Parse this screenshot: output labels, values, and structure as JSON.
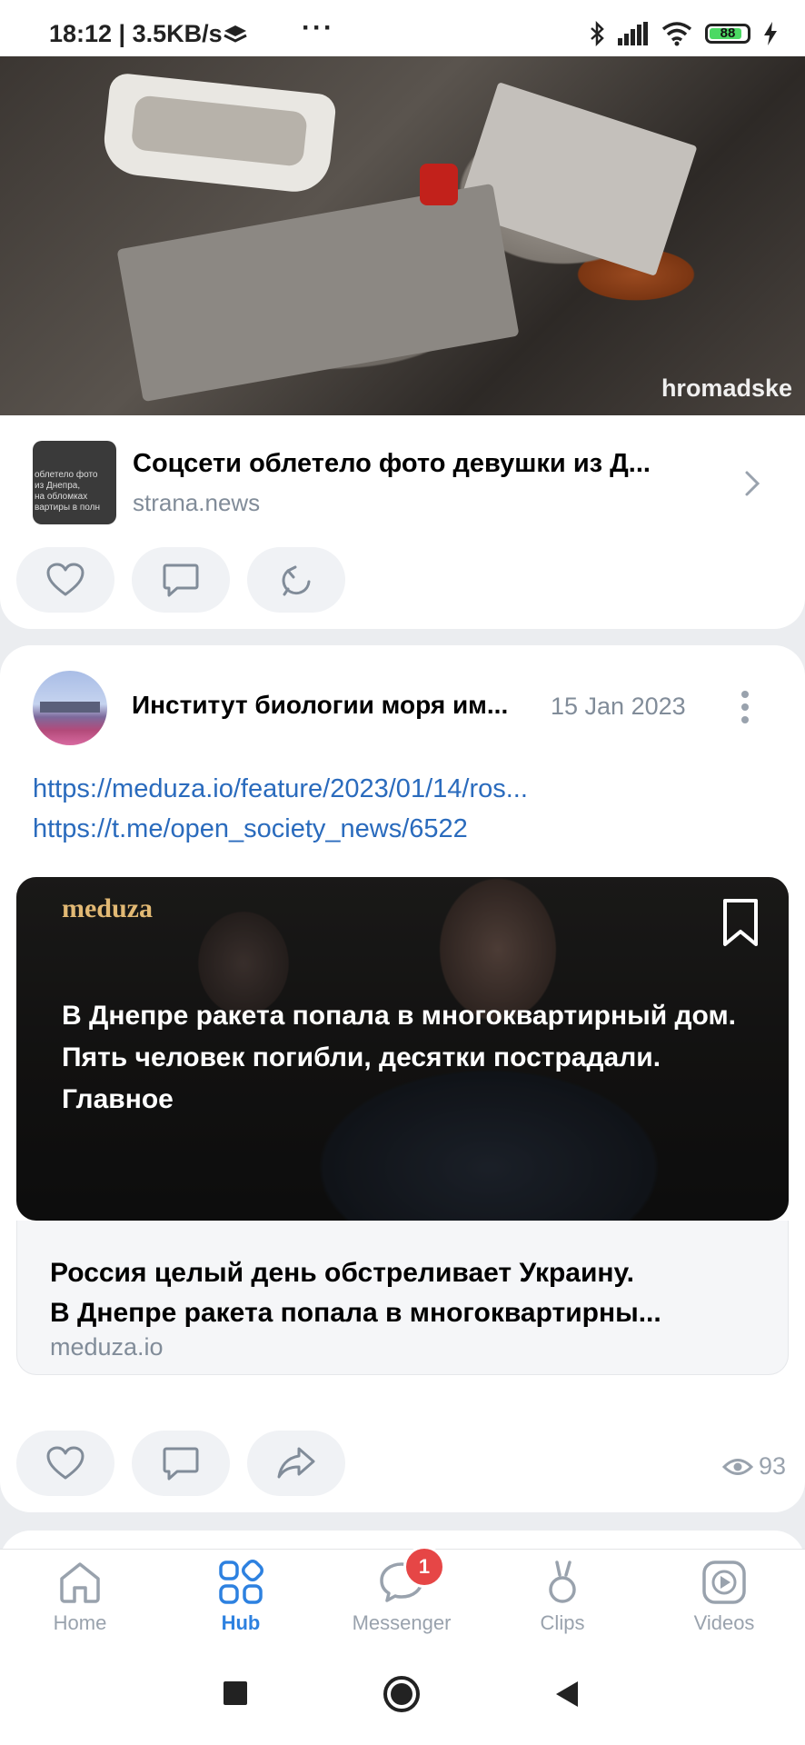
{
  "status_bar": {
    "time_and_speed": "18:12 | 3.5KB/s",
    "more": "···",
    "battery": "88"
  },
  "post1": {
    "hero_watermark": "hromadske",
    "thumb_caption": "облетело фото\nиз Днепра,\nна обломках\nвартиры в полн",
    "link_title": "Соцсети облетело фото девушки из Д...",
    "link_domain": "strana.news"
  },
  "post2": {
    "author": "Институт биологии моря им...",
    "date": "15 Jan 2023",
    "links": [
      "https://meduza.io/feature/2023/01/14/ros...",
      "https://t.me/open_society_news/6522"
    ],
    "media_logo": "meduza",
    "media_headline": "В Днепре ракета попала в многоквартирный дом. Пять человек погибли, десятки пострадали. Главное",
    "card_title_line1": "Россия целый день обстреливает Украину.",
    "card_title_line2": "В Днепре ракета попала в многоквартирны...",
    "card_domain": "meduza.io",
    "views": "93"
  },
  "tabbar": {
    "tabs": [
      {
        "label": "Home",
        "icon": "home-icon"
      },
      {
        "label": "Hub",
        "icon": "hub-icon"
      },
      {
        "label": "Messenger",
        "icon": "messenger-icon",
        "badge": "1"
      },
      {
        "label": "Clips",
        "icon": "clips-icon"
      },
      {
        "label": "Videos",
        "icon": "videos-icon"
      }
    ],
    "active": "Hub"
  },
  "colors": {
    "accent": "#2d81e0",
    "link": "#2a6bbd",
    "secondary_text": "#818c99",
    "badge": "#e64646",
    "meduza_gold": "#e2b974"
  }
}
